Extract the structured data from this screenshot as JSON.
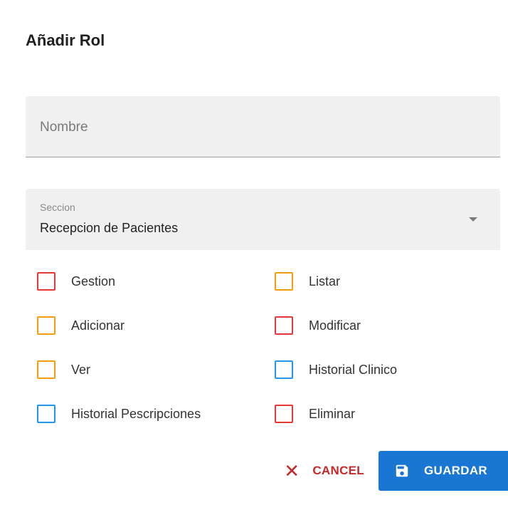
{
  "dialog": {
    "title": "Añadir Rol"
  },
  "name_field": {
    "placeholder": "Nombre",
    "value": ""
  },
  "section_select": {
    "label": "Seccion",
    "value": "Recepcion de Pacientes"
  },
  "permissions": [
    {
      "label": "Gestion",
      "color": "#e53935",
      "checked": false
    },
    {
      "label": "Listar",
      "color": "#f59e0b",
      "checked": false
    },
    {
      "label": "Adicionar",
      "color": "#f59e0b",
      "checked": false
    },
    {
      "label": "Modificar",
      "color": "#e53935",
      "checked": false
    },
    {
      "label": "Ver",
      "color": "#f59e0b",
      "checked": false
    },
    {
      "label": "Historial Clinico",
      "color": "#2196f3",
      "checked": false
    },
    {
      "label": "Historial Pescripciones",
      "color": "#2196f3",
      "checked": false
    },
    {
      "label": "Eliminar",
      "color": "#e53935",
      "checked": false
    }
  ],
  "actions": {
    "cancel_label": "CANCEL",
    "save_label": "GUARDAR",
    "cancel_icon": "close-icon",
    "save_icon": "floppy-disk-icon"
  }
}
